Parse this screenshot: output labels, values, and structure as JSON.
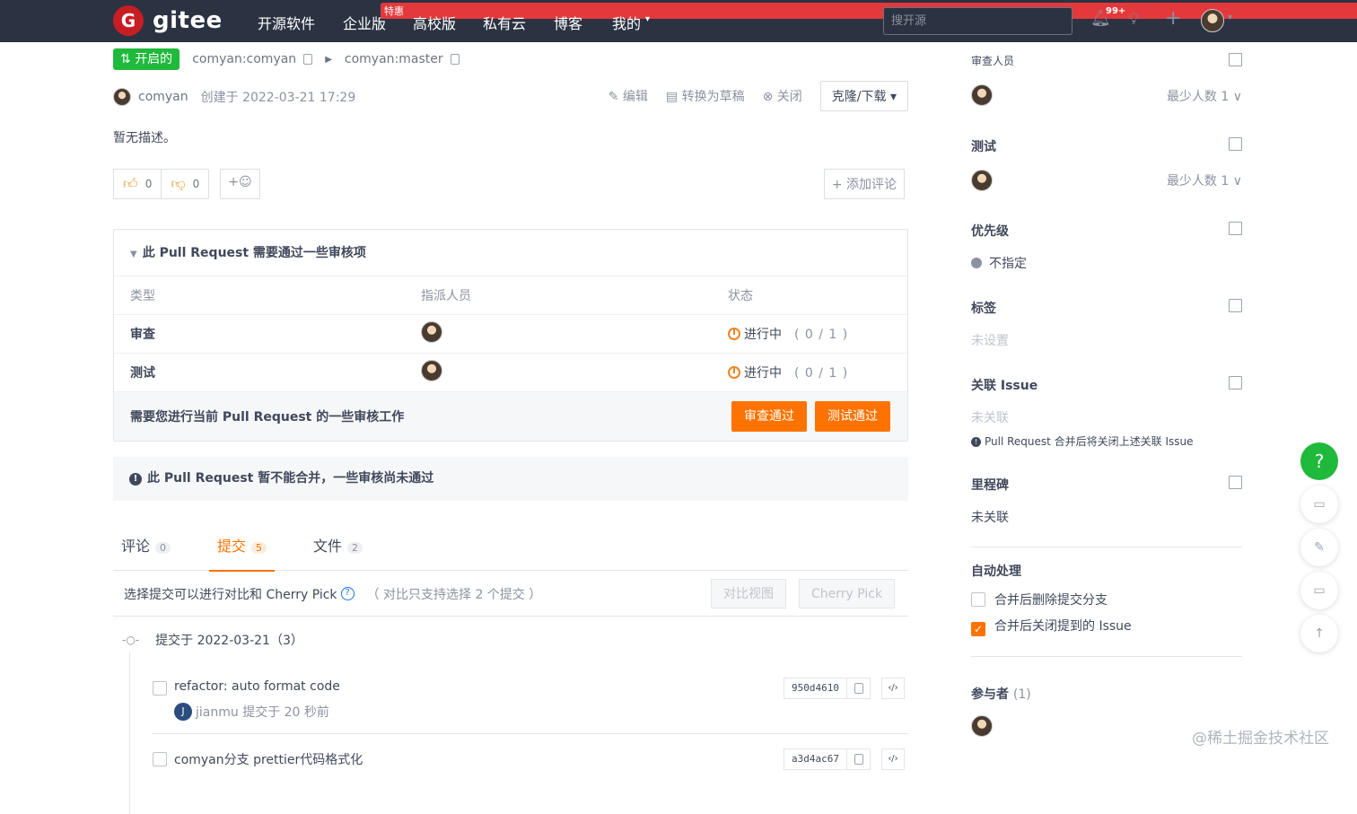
{
  "topbar": {
    "logo_letter": "G",
    "logo_text": "gitee",
    "nav": [
      "开源软件",
      "企业版",
      "高校版",
      "私有云",
      "博客",
      "我的"
    ],
    "nav_badge": "特惠",
    "search_placeholder": "搜开源",
    "notif_count": "99+"
  },
  "pr": {
    "status": "开启的",
    "source_branch": "comyan:comyan",
    "target_branch": "comyan:master",
    "author": "comyan",
    "created": "创建于 2022-03-21 17:29",
    "actions": [
      "编辑",
      "转换为草稿",
      "关闭"
    ],
    "clone_label": "克隆/下载",
    "description": "暂无描述。",
    "likes": "0",
    "dislikes": "0",
    "add_reaction": "+☺",
    "add_comment": "+ 添加评论"
  },
  "review": {
    "title": "此 Pull Request 需要通过一些审核项",
    "headers": [
      "类型",
      "指派人员",
      "状态"
    ],
    "rows": [
      {
        "type": "审查",
        "status": "进行中",
        "progress": "( 0 / 1 )"
      },
      {
        "type": "测试",
        "status": "进行中",
        "progress": "( 0 / 1 )"
      }
    ],
    "footer": "需要您进行当前 Pull Request 的一些审核工作",
    "btn_review": "审查通过",
    "btn_test": "测试通过"
  },
  "warning": "此 Pull Request 暂不能合并，一些审核尚未通过",
  "tabs": [
    {
      "label": "评论",
      "count": "0"
    },
    {
      "label": "提交",
      "count": "5"
    },
    {
      "label": "文件",
      "count": "2"
    }
  ],
  "compare": {
    "text": "选择提交可以进行对比和 Cherry Pick",
    "hint": "（ 对比只支持选择 2 个提交 ）",
    "btn_compare": "对比视图",
    "btn_cherry": "Cherry Pick"
  },
  "commits": {
    "date_header": "提交于 2022-03-21（3）",
    "items": [
      {
        "message": "refactor: auto format code",
        "author_initial": "J",
        "by": "jianmu 提交于 20 秒前",
        "sha": "950d4610"
      },
      {
        "message": "comyan分支 prettier代码格式化",
        "sha": "a3d4ac67"
      }
    ]
  },
  "sidebar": {
    "reviewers_title": "审查人员",
    "reviewers_min": "最少人数 1",
    "testers_title": "测试",
    "testers_min": "最少人数 1",
    "priority_title": "优先级",
    "priority_value": "不指定",
    "labels_title": "标签",
    "labels_value": "未设置",
    "issue_title": "关联 Issue",
    "issue_value": "未关联",
    "issue_note": "Pull Request 合并后将关闭上述关联 Issue",
    "milestone_title": "里程碑",
    "milestone_value": "未关联",
    "auto_title": "自动处理",
    "auto_delete": "合并后删除提交分支",
    "auto_close": "合并后关闭提到的 Issue",
    "participants_title": "参与者",
    "participants_count": "(1)"
  },
  "watermark": "@稀土掘金技术社区"
}
